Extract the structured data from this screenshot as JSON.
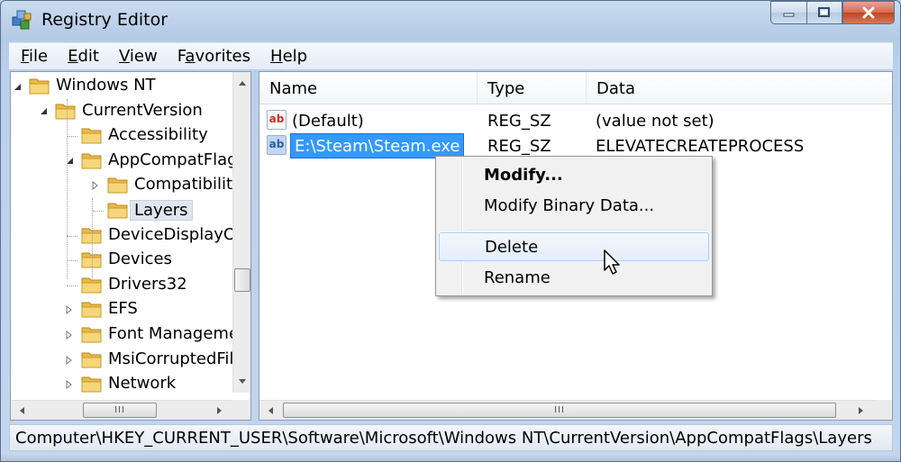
{
  "window": {
    "title": "Registry Editor",
    "controls": [
      "minimize",
      "maximize",
      "close"
    ]
  },
  "menubar": {
    "items": [
      {
        "mnemonic": "F",
        "rest": "ile"
      },
      {
        "mnemonic": "E",
        "rest": "dit"
      },
      {
        "mnemonic": "V",
        "rest": "iew"
      },
      {
        "pre": "F",
        "mnemonic": "a",
        "rest": "vorites"
      },
      {
        "mnemonic": "H",
        "rest": "elp"
      }
    ]
  },
  "tree": {
    "items": [
      {
        "label": "Windows NT",
        "expander": "expanded"
      },
      {
        "label": "CurrentVersion",
        "expander": "expanded"
      },
      {
        "label": "Accessibility",
        "expander": "none"
      },
      {
        "label": "AppCompatFlags",
        "expander": "expanded"
      },
      {
        "label": "Compatibility",
        "expander": "collapsed"
      },
      {
        "label": "Layers",
        "expander": "none",
        "selected": true
      },
      {
        "label": "DeviceDisplayObjects",
        "expander": "none"
      },
      {
        "label": "Devices",
        "expander": "none"
      },
      {
        "label": "Drivers32",
        "expander": "none"
      },
      {
        "label": "EFS",
        "expander": "collapsed"
      },
      {
        "label": "Font Management",
        "expander": "collapsed"
      },
      {
        "label": "MsiCorruptedFileRecovery",
        "expander": "collapsed"
      },
      {
        "label": "Network",
        "expander": "collapsed"
      }
    ]
  },
  "list": {
    "columns": [
      "Name",
      "Type",
      "Data"
    ],
    "rows": [
      {
        "icon": "ab",
        "name": "(Default)",
        "type": "REG_SZ",
        "data": "(value not set)"
      },
      {
        "icon": "ab",
        "name": "E:\\Steam\\Steam.exe",
        "type": "REG_SZ",
        "data": "ELEVATECREATEPROCESS",
        "editing": true
      }
    ]
  },
  "context_menu": {
    "items": [
      {
        "label": "Modify...",
        "bold": true
      },
      {
        "label": "Modify Binary Data..."
      },
      {
        "label": "Delete",
        "hovered": true
      },
      {
        "label": "Rename"
      }
    ]
  },
  "statusbar": {
    "path": "Computer\\HKEY_CURRENT_USER\\Software\\Microsoft\\Windows NT\\CurrentVersion\\AppCompatFlags\\Layers"
  },
  "colors": {
    "selection": "#3399ff",
    "menu_hover": "#e3eefb",
    "close_button": "#c4421f"
  }
}
